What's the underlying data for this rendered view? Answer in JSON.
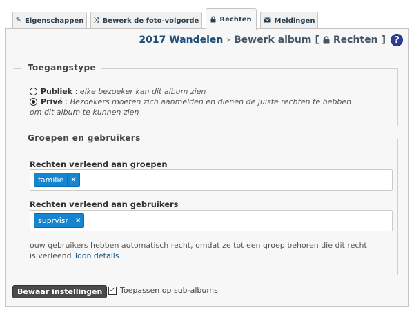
{
  "tabs": [
    {
      "label": "Eigenschappen",
      "icon": "pencil-icon",
      "active": false
    },
    {
      "label": "Bewerk de foto-volgorde",
      "icon": "shuffle-icon",
      "active": false
    },
    {
      "label": "Rechten",
      "icon": "lock-icon",
      "active": true
    },
    {
      "label": "Meldingen",
      "icon": "envelope-icon",
      "active": false
    }
  ],
  "header": {
    "album": "2017 Wandelen",
    "separator": "›",
    "action": "Bewerk album",
    "bracket_open": "[",
    "section": "Rechten",
    "bracket_close": "]",
    "help": "?"
  },
  "access": {
    "legend": "Toegangstype",
    "options": [
      {
        "label": "Publiek",
        "colon": " : ",
        "description": "elke bezoeker kan dit album zien",
        "selected": false
      },
      {
        "label": "Privé",
        "colon": " : ",
        "description": "Bezoekers moeten zich aanmelden en dienen de juiste rechten te hebben",
        "description2": "om dit album te kunnen zien",
        "selected": true
      }
    ]
  },
  "groups_users": {
    "legend": "Groepen en gebruikers",
    "groups_label": "Rechten verleend aan groepen",
    "groups": [
      {
        "name": "familie",
        "remove": "×"
      }
    ],
    "users_label": "Rechten verleend aan gebruikers",
    "users": [
      {
        "name": "suprvisr",
        "remove": "×"
      }
    ],
    "note_line1": "ouw gebruikers hebben automatisch recht, omdat ze tot een groep behoren die dit recht",
    "note_line2": "is verleend",
    "note_link": "Toon details"
  },
  "footer": {
    "save_label": "Bewaar instellingen",
    "apply_sub_label": "Toepassen op sub-albums",
    "apply_sub_checked": true,
    "check_mark": "✓"
  },
  "colors": {
    "tag_bg": "#1585cf",
    "help_bg": "#2d3d9b",
    "button_bg": "#4a4a4a",
    "title_color": "#1f4f7a"
  }
}
